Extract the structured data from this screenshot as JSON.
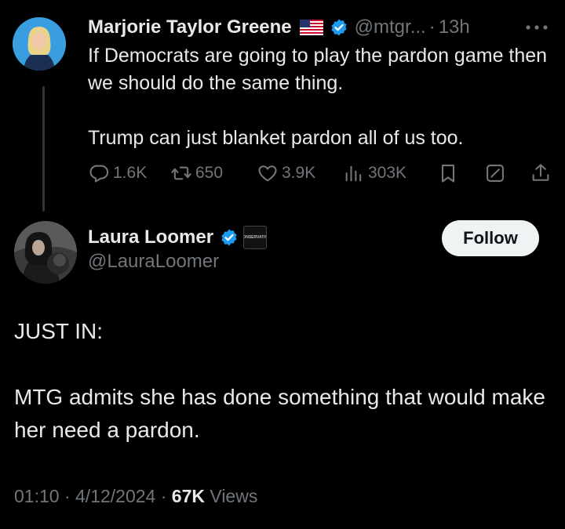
{
  "thread": {
    "parent_tweet": {
      "author_name": "Marjorie Taylor Greene",
      "flag_icon": "us-flag-icon",
      "verified_icon": "verified-badge-icon",
      "handle": "@mtgr...",
      "separator": "·",
      "time": "13h",
      "text_paragraphs": [
        "If Democrats are going to play the pardon game then we should do the same thing.",
        "Trump can just blanket pardon all of us too."
      ],
      "actions": {
        "replies": "1.6K",
        "reposts": "650",
        "likes": "3.9K",
        "views": "303K"
      }
    },
    "main_tweet": {
      "author_name": "Laura Loomer",
      "verified_icon": "verified-badge-icon",
      "affiliation_badge": "CONSERVATIVE",
      "handle": "@LauraLoomer",
      "follow_label": "Follow",
      "text_paragraphs": [
        "JUST IN:",
        "MTG admits she has done something that would make her need a pardon."
      ],
      "meta": {
        "time": "01:10",
        "separator": "·",
        "date": "4/12/2024",
        "separator2": "·",
        "views_count": "67K",
        "views_label": "Views"
      }
    }
  },
  "colors": {
    "background": "#000000",
    "primary_text": "#e7e9ea",
    "secondary_text": "#71767b",
    "verified_blue": "#1d9bf0",
    "follow_button_bg": "#eff3f4"
  }
}
